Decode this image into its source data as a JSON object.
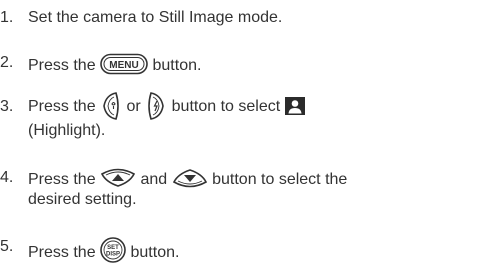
{
  "steps": [
    {
      "number": "1.",
      "text": "Set the camera to Still Image mode."
    },
    {
      "number": "2.",
      "pre": "Press the",
      "post": "button.",
      "icon": "menu-button-icon",
      "icon_label": "MENU"
    },
    {
      "number": "3.",
      "pre": "Press the",
      "mid1": "or",
      "mid2": "button to select",
      "cont": "(Highlight).",
      "icons": [
        "macro-left-button-icon",
        "flash-right-button-icon",
        "highlight-mode-icon"
      ]
    },
    {
      "number": "4.",
      "pre": "Press the",
      "mid": "and",
      "post": "button to select the",
      "cont": "desired setting.",
      "icons": [
        "up-arrow-button-icon",
        "down-arrow-button-icon"
      ]
    },
    {
      "number": "5.",
      "pre": "Press the",
      "post": "button.",
      "icon": "set-disp-button-icon",
      "icon_label_1": "SET",
      "icon_label_2": "DISP"
    }
  ]
}
